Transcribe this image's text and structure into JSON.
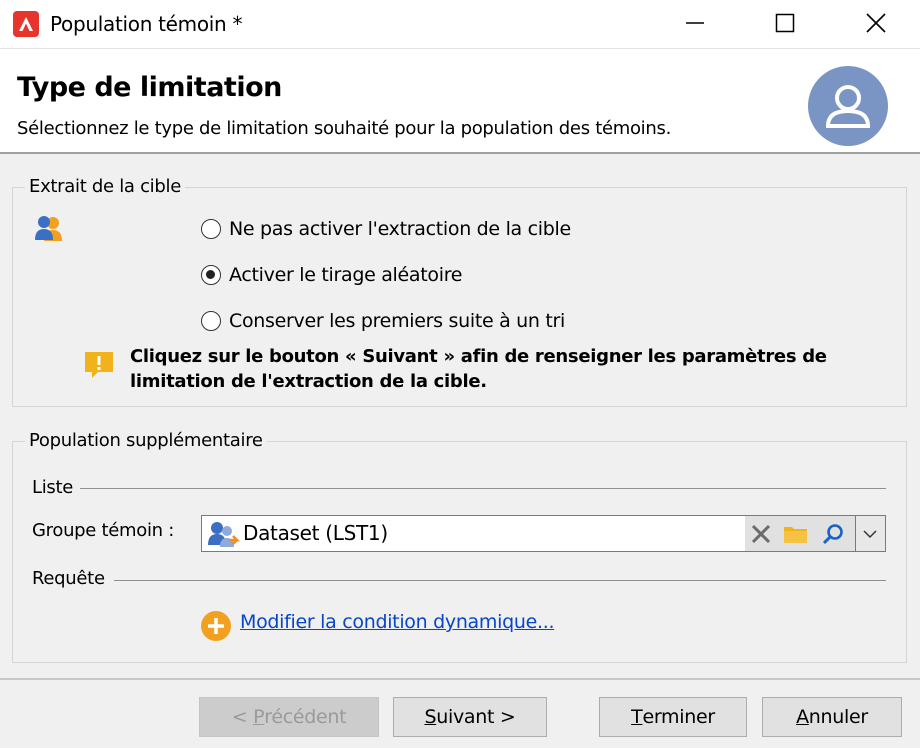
{
  "window": {
    "title": "Population témoin *",
    "controls": [
      "minimize",
      "maximize",
      "close"
    ]
  },
  "header": {
    "title": "Type de limitation",
    "subtitle": "Sélectionnez le type de limitation souhaité pour la population des témoins.",
    "avatar_icon": "user-avatar-icon"
  },
  "target_extract": {
    "group_title": "Extrait de la cible",
    "options": [
      {
        "label": "Ne pas activer l'extraction de la cible",
        "checked": false
      },
      {
        "label": "Activer le tirage aléatoire",
        "checked": true
      },
      {
        "label": "Conserver les premiers suite à un tri",
        "checked": false
      }
    ],
    "info_line1": "Cliquez sur le bouton « Suivant » afin de renseigner les paramètres de",
    "info_line2": "limitation de l'extraction de la cible."
  },
  "additional_population": {
    "group_title": "Population supplémentaire",
    "list_label": "Liste",
    "control_group_label": "Groupe témoin :",
    "control_group_value": "Dataset (LST1)",
    "query_label": "Requête",
    "dynamic_condition_link": "Modifier la condition dynamique..."
  },
  "footer": {
    "previous_prefix": "< ",
    "previous_mnemonic": "P",
    "previous_rest": "récédent",
    "next_mnemonic": "S",
    "next_rest": "uivant >",
    "finish_mnemonic": "T",
    "finish_rest": "erminer",
    "cancel_mnemonic": "A",
    "cancel_rest": "nnuler"
  },
  "colors": {
    "app_icon": "#e7342c",
    "avatar": "#7a95c4",
    "link": "#0645cc",
    "warning": "#f2b31a"
  }
}
